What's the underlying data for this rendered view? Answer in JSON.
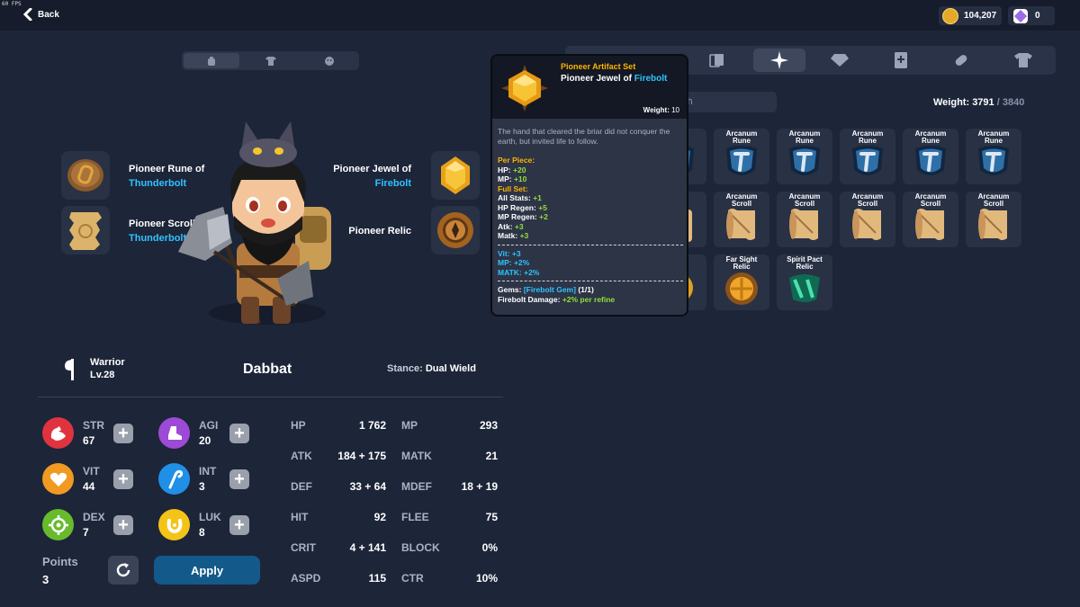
{
  "hud": {
    "fps": "60 FPS",
    "back_label": "Back",
    "gold": "104,207",
    "gems": "0"
  },
  "equip_tabs": [
    "hat-icon",
    "shirt-icon",
    "face-icon"
  ],
  "equipment": {
    "left": [
      {
        "line1": "Pioneer Rune of",
        "line2": "Thunderbolt"
      },
      {
        "line1": "Pioneer Scroll",
        "line2": "Thunderbolt"
      }
    ],
    "right": [
      {
        "line1": "Pioneer Jewel of",
        "line2": "Firebolt"
      },
      {
        "line1": "Pioneer Relic",
        "line2": ""
      }
    ]
  },
  "character": {
    "class": "Warrior",
    "level": "Lv.28",
    "name": "Dabbat",
    "stance_label": "Stance:",
    "stance": "Dual Wield"
  },
  "base_stats": [
    {
      "key": "STR",
      "value": "67",
      "color": "#e0333f"
    },
    {
      "key": "AGI",
      "value": "20",
      "color": "#9d4ad6"
    },
    {
      "key": "VIT",
      "value": "44",
      "color": "#f09a22"
    },
    {
      "key": "INT",
      "value": "3",
      "color": "#1f8fe8"
    },
    {
      "key": "DEX",
      "value": "7",
      "color": "#67bb2c"
    },
    {
      "key": "LUK",
      "value": "8",
      "color": "#f3c317"
    }
  ],
  "points": {
    "label": "Points",
    "value": "3"
  },
  "apply_label": "Apply",
  "derived": [
    {
      "k": "HP",
      "v": "1 762",
      "k2": "MP",
      "v2": "293"
    },
    {
      "k": "ATK",
      "v": "184 + 175",
      "k2": "MATK",
      "v2": "21"
    },
    {
      "k": "DEF",
      "v": "33 + 64",
      "k2": "MDEF",
      "v2": "18 + 19"
    },
    {
      "k": "HIT",
      "v": "92",
      "k2": "FLEE",
      "v2": "75"
    },
    {
      "k": "CRIT",
      "v": "4 + 141",
      "k2": "BLOCK",
      "v2": "0%"
    },
    {
      "k": "ASPD",
      "v": "115",
      "k2": "CTR",
      "v2": "10%"
    }
  ],
  "inventory": {
    "search_placeholder": "ch",
    "weight_label": "Weight:",
    "weight_current": "3791",
    "weight_sep": "/",
    "weight_max": "3840",
    "row1": [
      "",
      "Arcanum\nRune",
      "Arcanum\nRune",
      "Arcanum\nRune",
      "Arcanum\nRune",
      "Arcanum\nRune"
    ],
    "row2": [
      "",
      "Arcanum\nScroll",
      "Arcanum\nScroll",
      "Arcanum\nScroll",
      "Arcanum\nScroll",
      "Arcanum\nScroll"
    ],
    "row3": [
      "t",
      "Far Sight\nRelic",
      "Spirit Pact\nRelic"
    ]
  },
  "tooltip": {
    "set_name": "Pioneer Artifact Set",
    "item_name_prefix": "Pioneer Jewel of ",
    "item_name_element": "Firebolt",
    "weight_label": "Weight:",
    "weight": "10",
    "description": "The hand that cleared the briar did not conquer the earth, but invited life to follow.",
    "per_piece_label": "Per Piece:",
    "per_piece": [
      {
        "k": "HP:",
        "v": "+20"
      },
      {
        "k": "MP:",
        "v": "+10"
      }
    ],
    "full_set_label": "Full Set:",
    "full_set": [
      {
        "k": "All Stats:",
        "v": "+1"
      },
      {
        "k": "HP Regen:",
        "v": "+5"
      },
      {
        "k": "MP Regen:",
        "v": "+2"
      },
      {
        "k": "Atk:",
        "v": "+3"
      },
      {
        "k": "Matk:",
        "v": "+3"
      }
    ],
    "item_stats": [
      "Vit: +3",
      "MP: +2%",
      "MATK: +2%"
    ],
    "gems_label": "Gems:",
    "gem": "[Firebolt Gem]",
    "gem_count": "(1/1)",
    "bonus_label": "Firebolt Damage:",
    "bonus": "+2% per refine"
  }
}
